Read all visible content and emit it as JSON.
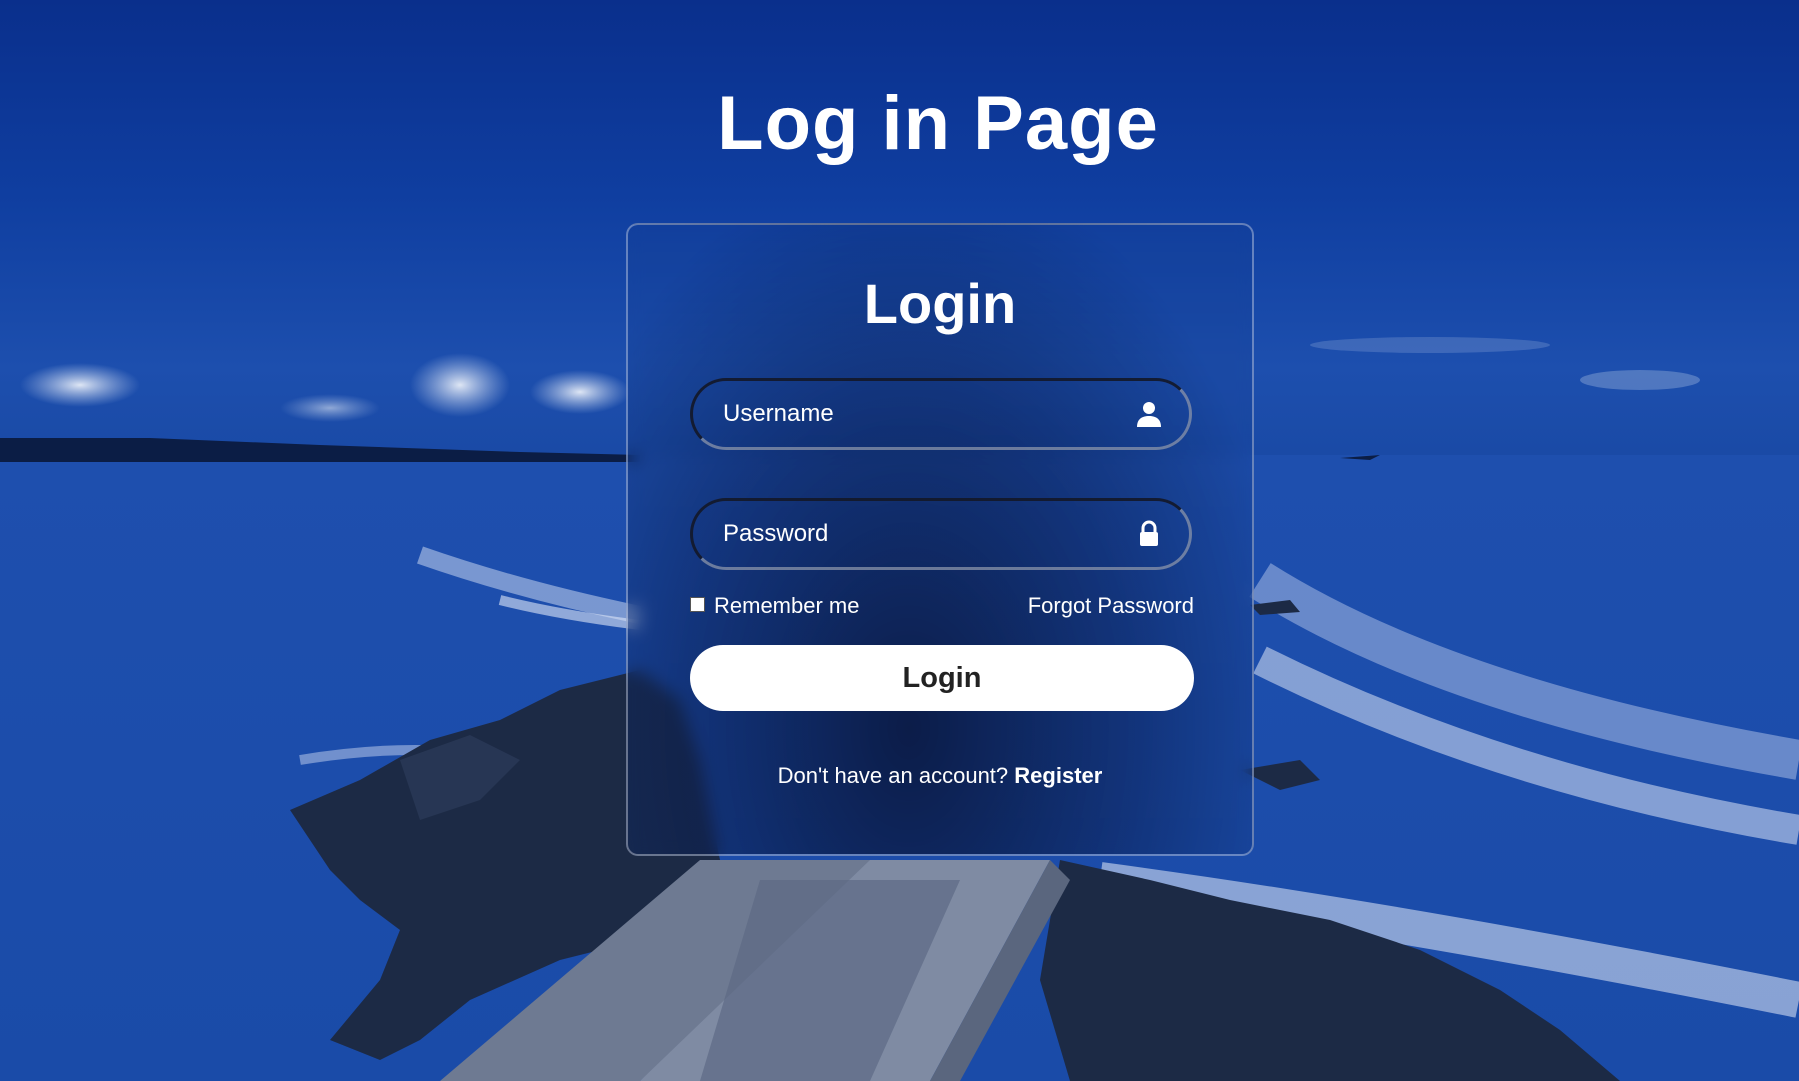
{
  "page": {
    "title": "Log in Page"
  },
  "login_form": {
    "title": "Login",
    "username": {
      "placeholder": "Username",
      "value": "",
      "icon": "user-icon"
    },
    "password": {
      "placeholder": "Password",
      "value": "",
      "icon": "lock-icon"
    },
    "remember_me": {
      "label": "Remember me",
      "checked": false
    },
    "forgot_password_label": "Forgot Password",
    "submit_label": "Login",
    "register_prompt": "Don't have an account?",
    "register_link": "Register"
  },
  "colors": {
    "background_top": "#0a2f8c",
    "background_mid": "#1d4fae",
    "text": "#ffffff",
    "button_background": "#ffffff",
    "button_text": "#222222"
  }
}
